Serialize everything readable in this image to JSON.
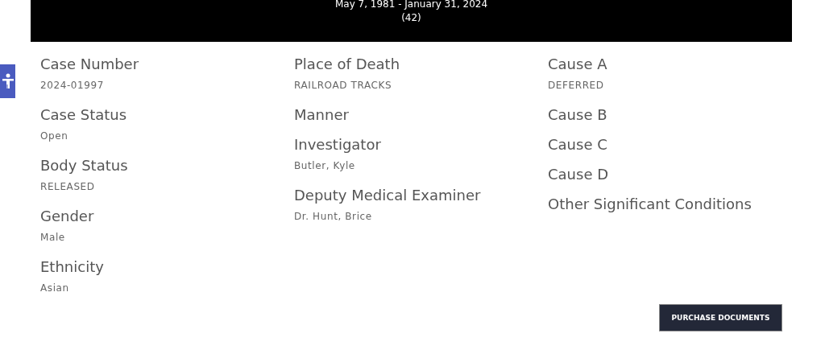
{
  "header": {
    "dates": "May 7, 1981 - January 31, 2024",
    "age": "(42)"
  },
  "columns": [
    [
      {
        "label": "Case Number",
        "value": "2024-01997"
      },
      {
        "label": "Case Status",
        "value": "Open"
      },
      {
        "label": "Body Status",
        "value": "RELEASED"
      },
      {
        "label": "Gender",
        "value": "Male"
      },
      {
        "label": "Ethnicity",
        "value": "Asian"
      }
    ],
    [
      {
        "label": "Place of Death",
        "value": "RAILROAD TRACKS"
      },
      {
        "label": "Manner"
      },
      {
        "label": "Investigator",
        "value": "Butler, Kyle"
      },
      {
        "label": "Deputy Medical Examiner",
        "value": "Dr. Hunt, Brice"
      }
    ],
    [
      {
        "label": "Cause A",
        "value": "DEFERRED"
      },
      {
        "label": "Cause B"
      },
      {
        "label": "Cause C"
      },
      {
        "label": "Cause D"
      },
      {
        "label": "Other Significant Conditions"
      }
    ]
  ],
  "button": "PURCHASE DOCUMENTS"
}
